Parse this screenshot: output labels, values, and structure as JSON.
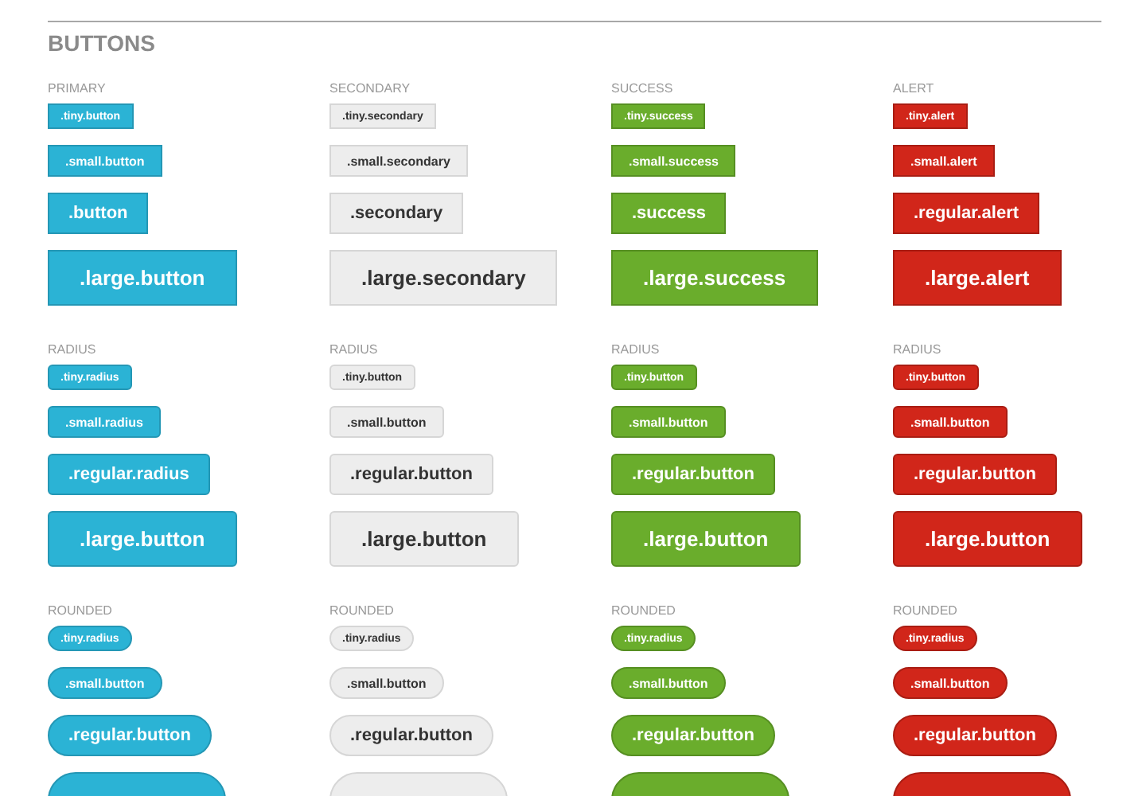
{
  "title": "BUTTONS",
  "sections": [
    {
      "columns": [
        {
          "label": "PRIMARY",
          "buttons": [
            {
              "kind": "labeled",
              "label": ".tiny.button"
            },
            {
              "kind": "labeled",
              "label": ".small.button"
            },
            {
              "kind": "labeled",
              "label": ".button"
            },
            {
              "kind": "labeled",
              "label": ".large.button"
            }
          ]
        },
        {
          "label": "SECONDARY",
          "buttons": [
            {
              "kind": "labeled",
              "label": ".tiny.secondary"
            },
            {
              "kind": "labeled",
              "label": ".small.secondary"
            },
            {
              "kind": "labeled",
              "label": ".secondary"
            },
            {
              "kind": "labeled",
              "label": ".large.secondary"
            }
          ]
        },
        {
          "label": "SUCCESS",
          "buttons": [
            {
              "kind": "labeled",
              "label": ".tiny.success"
            },
            {
              "kind": "labeled",
              "label": ".small.success"
            },
            {
              "kind": "labeled",
              "label": ".success"
            },
            {
              "kind": "labeled",
              "label": ".large.success"
            }
          ]
        },
        {
          "label": "ALERT",
          "buttons": [
            {
              "kind": "labeled",
              "label": ".tiny.alert"
            },
            {
              "kind": "labeled",
              "label": ".small.alert"
            },
            {
              "kind": "labeled",
              "label": ".regular.alert"
            },
            {
              "kind": "labeled",
              "label": ".large.alert"
            }
          ]
        }
      ]
    },
    {
      "columns": [
        {
          "label": "RADIUS",
          "buttons": [
            {
              "kind": "labeled",
              "label": ".tiny.radius"
            },
            {
              "kind": "labeled",
              "label": ".small.radius"
            },
            {
              "kind": "labeled",
              "label": ".regular.radius"
            },
            {
              "kind": "labeled",
              "label": ".large.button"
            }
          ]
        },
        {
          "label": "RADIUS",
          "buttons": [
            {
              "kind": "labeled",
              "label": ".tiny.button"
            },
            {
              "kind": "labeled",
              "label": ".small.button"
            },
            {
              "kind": "labeled",
              "label": ".regular.button"
            },
            {
              "kind": "labeled",
              "label": ".large.button"
            }
          ]
        },
        {
          "label": "RADIUS",
          "buttons": [
            {
              "kind": "labeled",
              "label": ".tiny.button"
            },
            {
              "kind": "labeled",
              "label": ".small.button"
            },
            {
              "kind": "labeled",
              "label": ".regular.button"
            },
            {
              "kind": "labeled",
              "label": ".large.button"
            }
          ]
        },
        {
          "label": "RADIUS",
          "buttons": [
            {
              "kind": "labeled",
              "label": ".tiny.button"
            },
            {
              "kind": "labeled",
              "label": ".small.button"
            },
            {
              "kind": "labeled",
              "label": ".regular.button"
            },
            {
              "kind": "labeled",
              "label": ".large.button"
            }
          ]
        }
      ]
    },
    {
      "columns": [
        {
          "label": "ROUNDED",
          "buttons": [
            {
              "kind": "labeled",
              "label": ".tiny.radius"
            },
            {
              "kind": "labeled",
              "label": ".small.button"
            },
            {
              "kind": "labeled",
              "label": ".regular.button"
            },
            {
              "kind": "cut-off"
            }
          ]
        },
        {
          "label": "ROUNDED",
          "buttons": [
            {
              "kind": "labeled",
              "label": ".tiny.radius"
            },
            {
              "kind": "labeled",
              "label": ".small.button"
            },
            {
              "kind": "labeled",
              "label": ".regular.button"
            },
            {
              "kind": "cut-off"
            }
          ]
        },
        {
          "label": "ROUNDED",
          "buttons": [
            {
              "kind": "labeled",
              "label": ".tiny.radius"
            },
            {
              "kind": "labeled",
              "label": ".small.button"
            },
            {
              "kind": "labeled",
              "label": ".regular.button"
            },
            {
              "kind": "cut-off"
            }
          ]
        },
        {
          "label": "ROUNDED",
          "buttons": [
            {
              "kind": "labeled",
              "label": ".tiny.radius"
            },
            {
              "kind": "labeled",
              "label": ".small.button"
            },
            {
              "kind": "labeled",
              "label": ".regular.button"
            },
            {
              "kind": "cut-off"
            }
          ]
        }
      ]
    }
  ]
}
